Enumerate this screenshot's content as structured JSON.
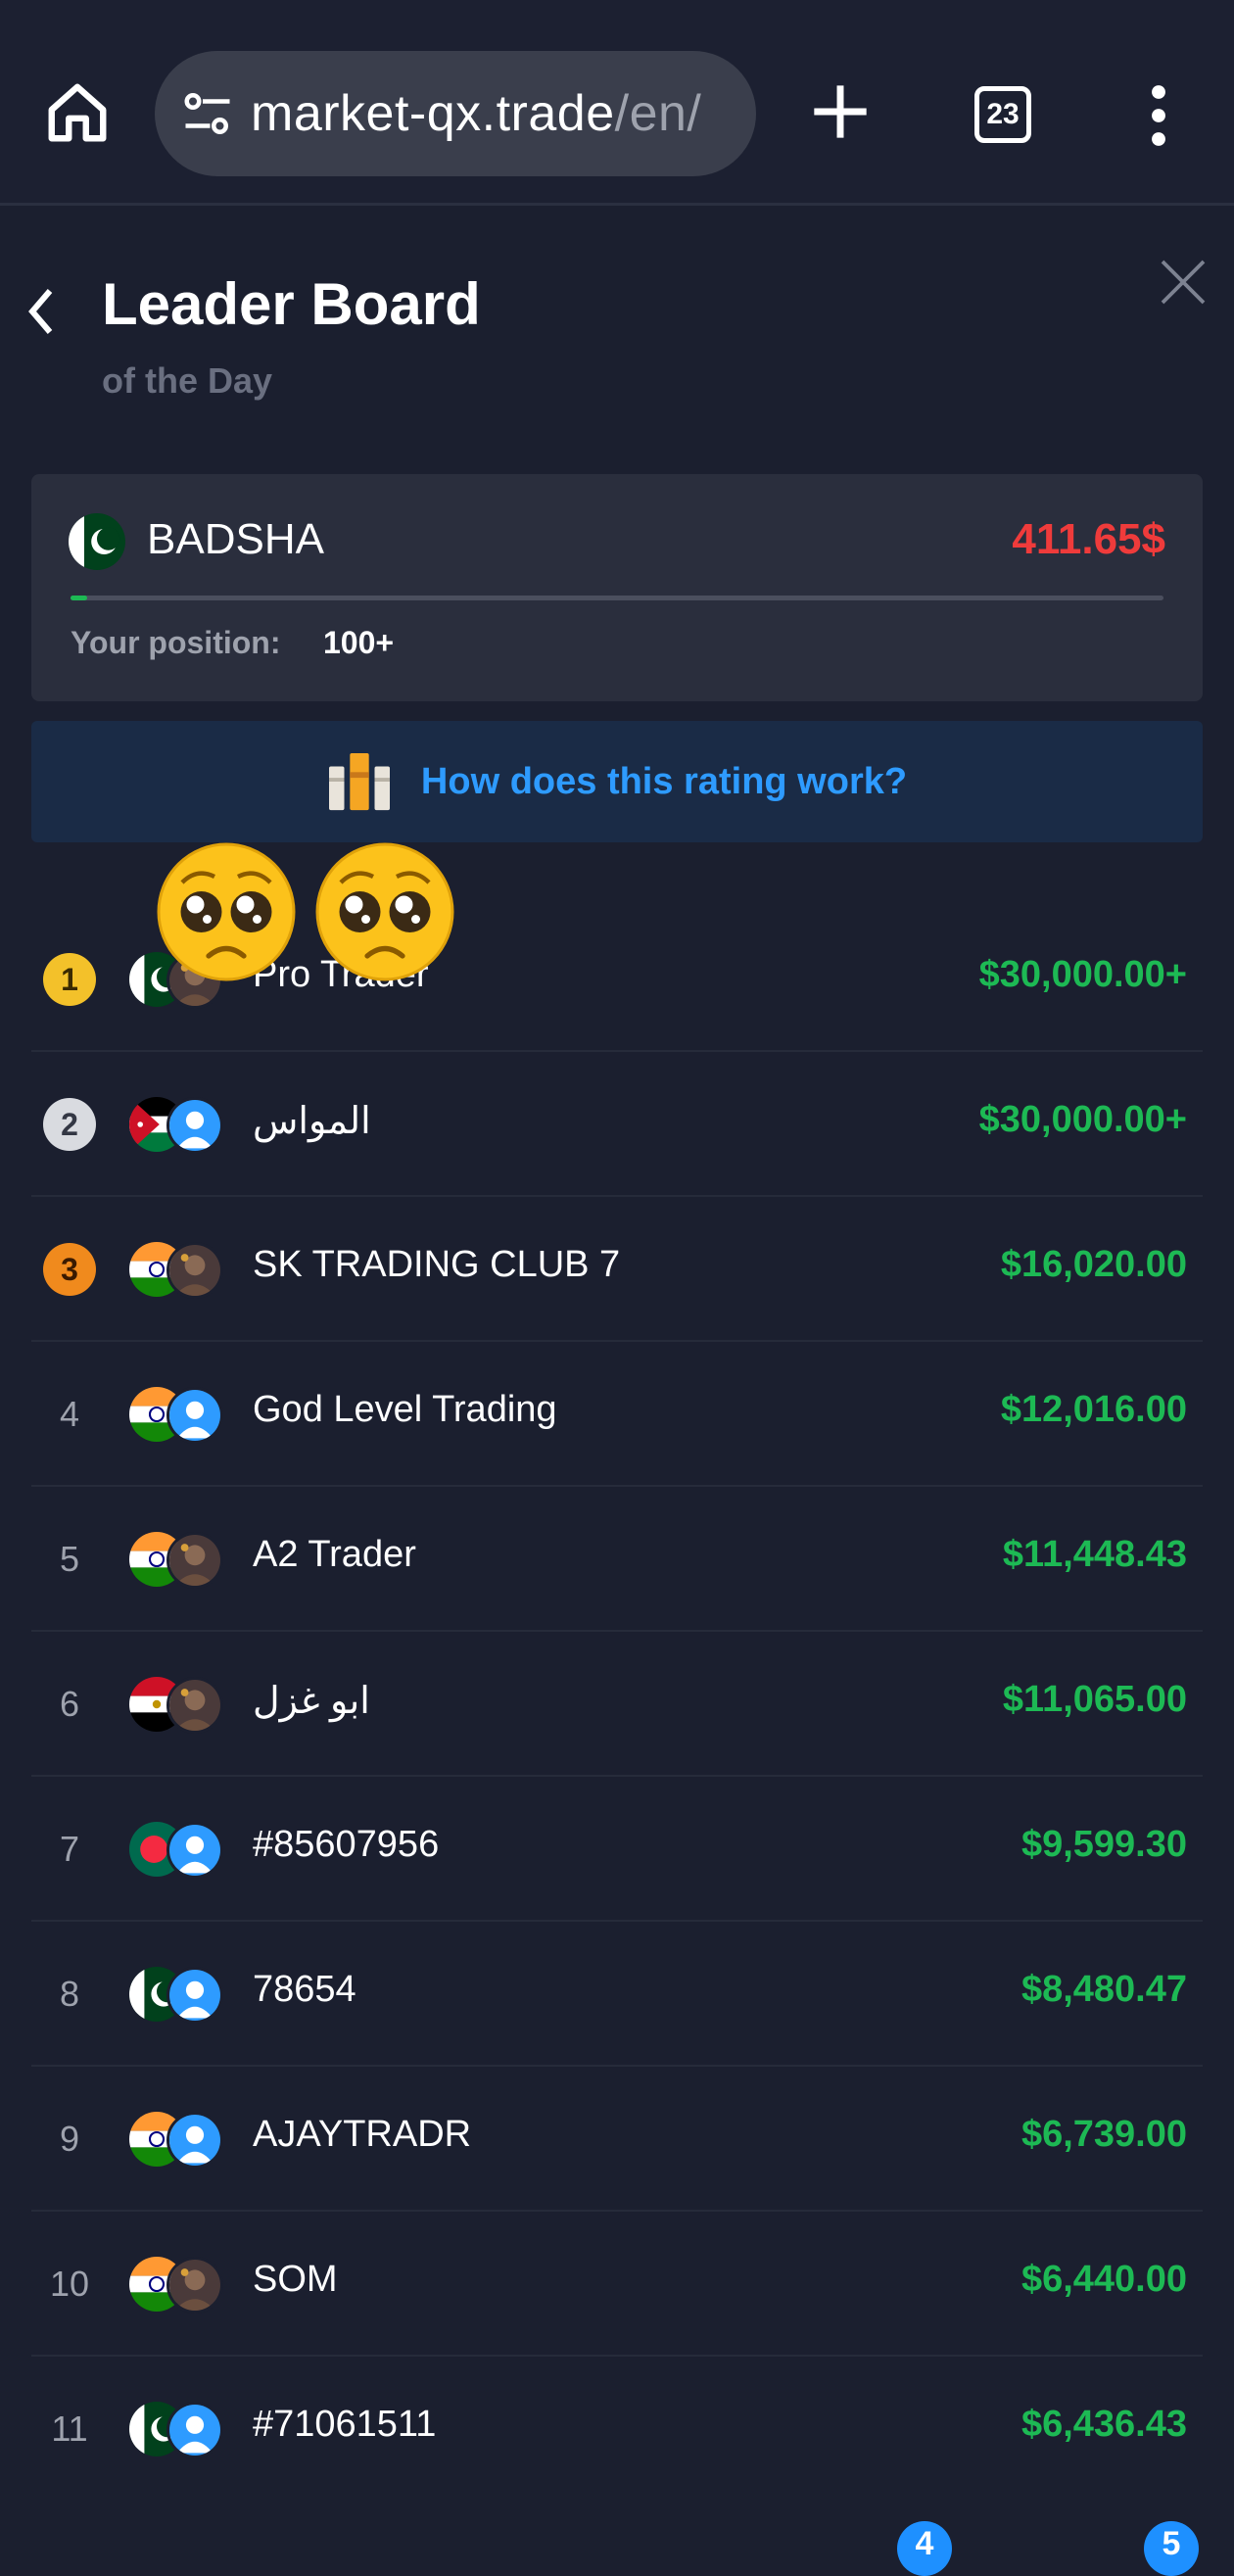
{
  "browser": {
    "url_host": "market-qx.trade",
    "url_path": "/en/",
    "tab_count": "23"
  },
  "header": {
    "title": "Leader Board",
    "subtitle": "of the Day"
  },
  "user": {
    "name": "BADSHA",
    "profit": "411.65$",
    "position_label": "Your position:",
    "position_value": "100+"
  },
  "rating_link": "How does this rating work?",
  "leaderboard": [
    {
      "rank": "1",
      "name": "Pro Trader",
      "profit": "$30,000.00+",
      "flag": "pk",
      "avatar": "photo"
    },
    {
      "rank": "2",
      "name": "المواس",
      "profit": "$30,000.00+",
      "flag": "jo",
      "avatar": "default"
    },
    {
      "rank": "3",
      "name": "SK TRADING CLUB 7",
      "profit": "$16,020.00",
      "flag": "in",
      "avatar": "photo"
    },
    {
      "rank": "4",
      "name": "God Level Trading",
      "profit": "$12,016.00",
      "flag": "in",
      "avatar": "default"
    },
    {
      "rank": "5",
      "name": "A2 Trader",
      "profit": "$11,448.43",
      "flag": "in",
      "avatar": "photo"
    },
    {
      "rank": "6",
      "name": "ابو غزل",
      "profit": "$11,065.00",
      "flag": "eg",
      "avatar": "photo"
    },
    {
      "rank": "7",
      "name": "#85607956",
      "profit": "$9,599.30",
      "flag": "bd",
      "avatar": "default"
    },
    {
      "rank": "8",
      "name": "78654",
      "profit": "$8,480.47",
      "flag": "pk",
      "avatar": "default"
    },
    {
      "rank": "9",
      "name": "AJAYTRADR",
      "profit": "$6,739.00",
      "flag": "in",
      "avatar": "default"
    },
    {
      "rank": "10",
      "name": "SOM",
      "profit": "$6,440.00",
      "flag": "in",
      "avatar": "photo"
    },
    {
      "rank": "11",
      "name": "#71061511",
      "profit": "$6,436.43",
      "flag": "pk",
      "avatar": "default"
    }
  ],
  "bottom_badges": [
    "4",
    "5"
  ],
  "colors": {
    "background": "#1b1f2f",
    "profit_green": "#1db954",
    "loss_red": "#ef3b3b",
    "link_blue": "#2e9bff"
  },
  "user_progress": 0.015
}
